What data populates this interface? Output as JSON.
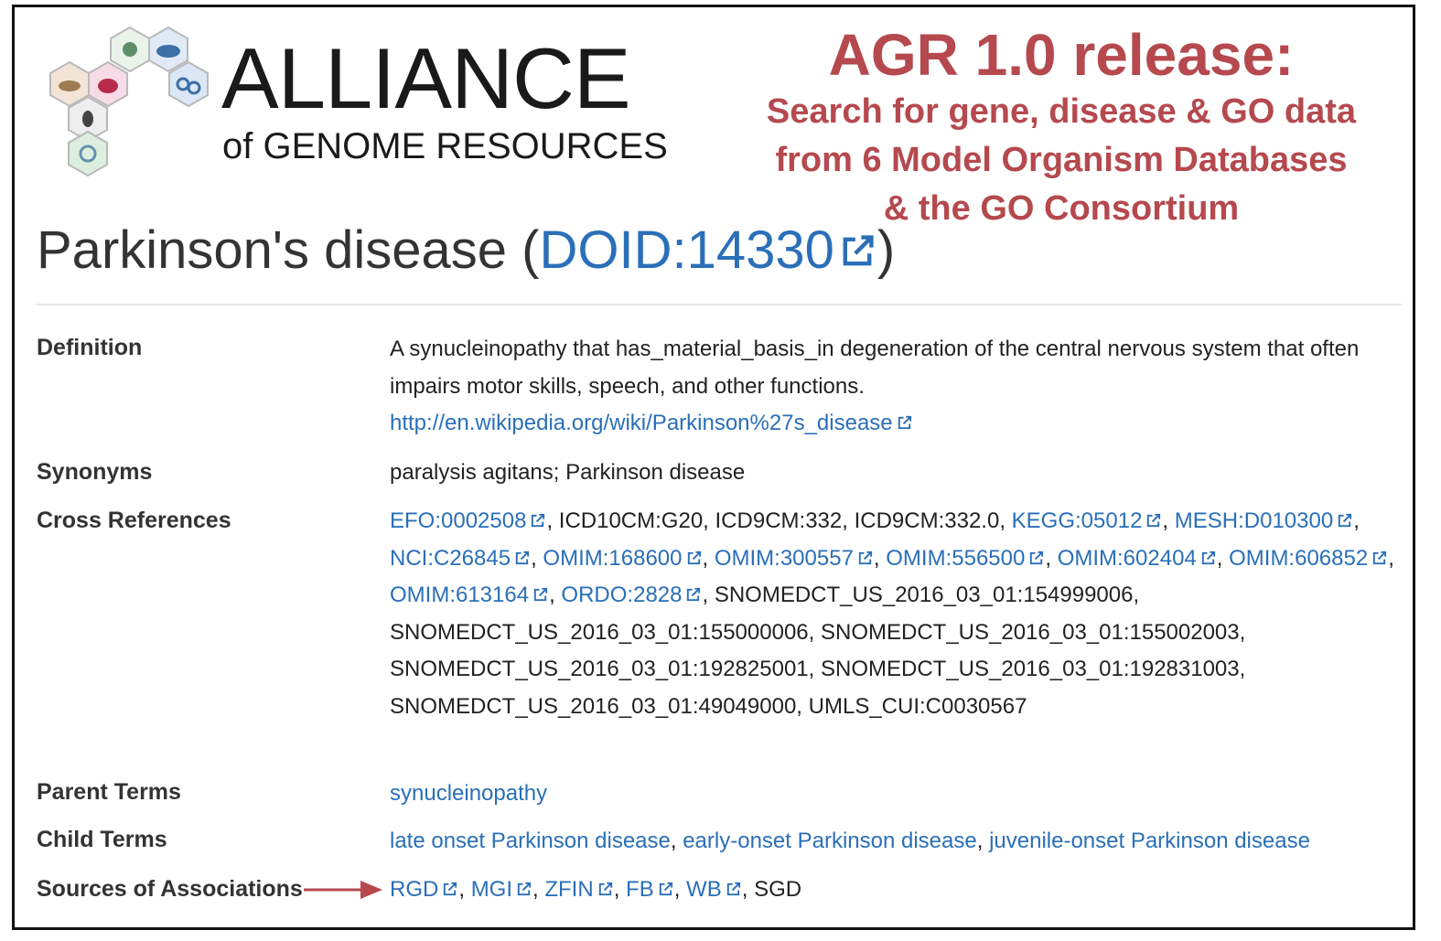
{
  "brand": {
    "title": "ALLIANCE",
    "subtitle": "of GENOME RESOURCES"
  },
  "release": {
    "title": "AGR 1.0 release:",
    "lines": [
      "Search for gene, disease & GO data",
      "from 6 Model Organism Databases",
      "& the GO Consortium"
    ]
  },
  "disease": {
    "name": "Parkinson's disease",
    "open_paren": "(",
    "doid": "DOID:14330",
    "close_paren": ")"
  },
  "labels": {
    "definition": "Definition",
    "synonyms": "Synonyms",
    "cross_references": "Cross References",
    "parent_terms": "Parent Terms",
    "child_terms": "Child Terms",
    "sources": "Sources of Associations"
  },
  "definition": {
    "text": "A synucleinopathy that has_material_basis_in degeneration of the central nervous system that often impairs motor skills, speech, and other functions.",
    "url": "http://en.wikipedia.org/wiki/Parkinson%27s_disease"
  },
  "synonyms": "paralysis agitans; Parkinson disease",
  "cross_references": [
    {
      "id": "EFO:0002508",
      "link": true
    },
    {
      "id": "ICD10CM:G20",
      "link": false
    },
    {
      "id": "ICD9CM:332",
      "link": false
    },
    {
      "id": "ICD9CM:332.0",
      "link": false
    },
    {
      "id": "KEGG:05012",
      "link": true
    },
    {
      "id": "MESH:D010300",
      "link": true
    },
    {
      "id": "NCI:C26845",
      "link": true
    },
    {
      "id": "OMIM:168600",
      "link": true
    },
    {
      "id": "OMIM:300557",
      "link": true
    },
    {
      "id": "OMIM:556500",
      "link": true
    },
    {
      "id": "OMIM:602404",
      "link": true
    },
    {
      "id": "OMIM:606852",
      "link": true
    },
    {
      "id": "OMIM:613164",
      "link": true
    },
    {
      "id": "ORDO:2828",
      "link": true
    },
    {
      "id": "SNOMEDCT_US_2016_03_01:154999006",
      "link": false
    },
    {
      "id": "SNOMEDCT_US_2016_03_01:155000006",
      "link": false
    },
    {
      "id": "SNOMEDCT_US_2016_03_01:155002003",
      "link": false
    },
    {
      "id": "SNOMEDCT_US_2016_03_01:192825001",
      "link": false
    },
    {
      "id": "SNOMEDCT_US_2016_03_01:192831003",
      "link": false
    },
    {
      "id": "SNOMEDCT_US_2016_03_01:49049000",
      "link": false
    },
    {
      "id": "UMLS_CUI:C0030567",
      "link": false
    }
  ],
  "parent_terms": [
    "synucleinopathy"
  ],
  "child_terms": [
    "late onset Parkinson disease",
    "early-onset Parkinson disease",
    "juvenile-onset Parkinson disease"
  ],
  "sources": [
    {
      "id": "RGD",
      "link": true
    },
    {
      "id": "MGI",
      "link": true
    },
    {
      "id": "ZFIN",
      "link": true
    },
    {
      "id": "FB",
      "link": true
    },
    {
      "id": "WB",
      "link": true
    },
    {
      "id": "SGD",
      "link": false
    }
  ],
  "colors": {
    "link": "#2a6fb8",
    "release_accent": "#b5494e",
    "arrow": "#b5494e"
  }
}
